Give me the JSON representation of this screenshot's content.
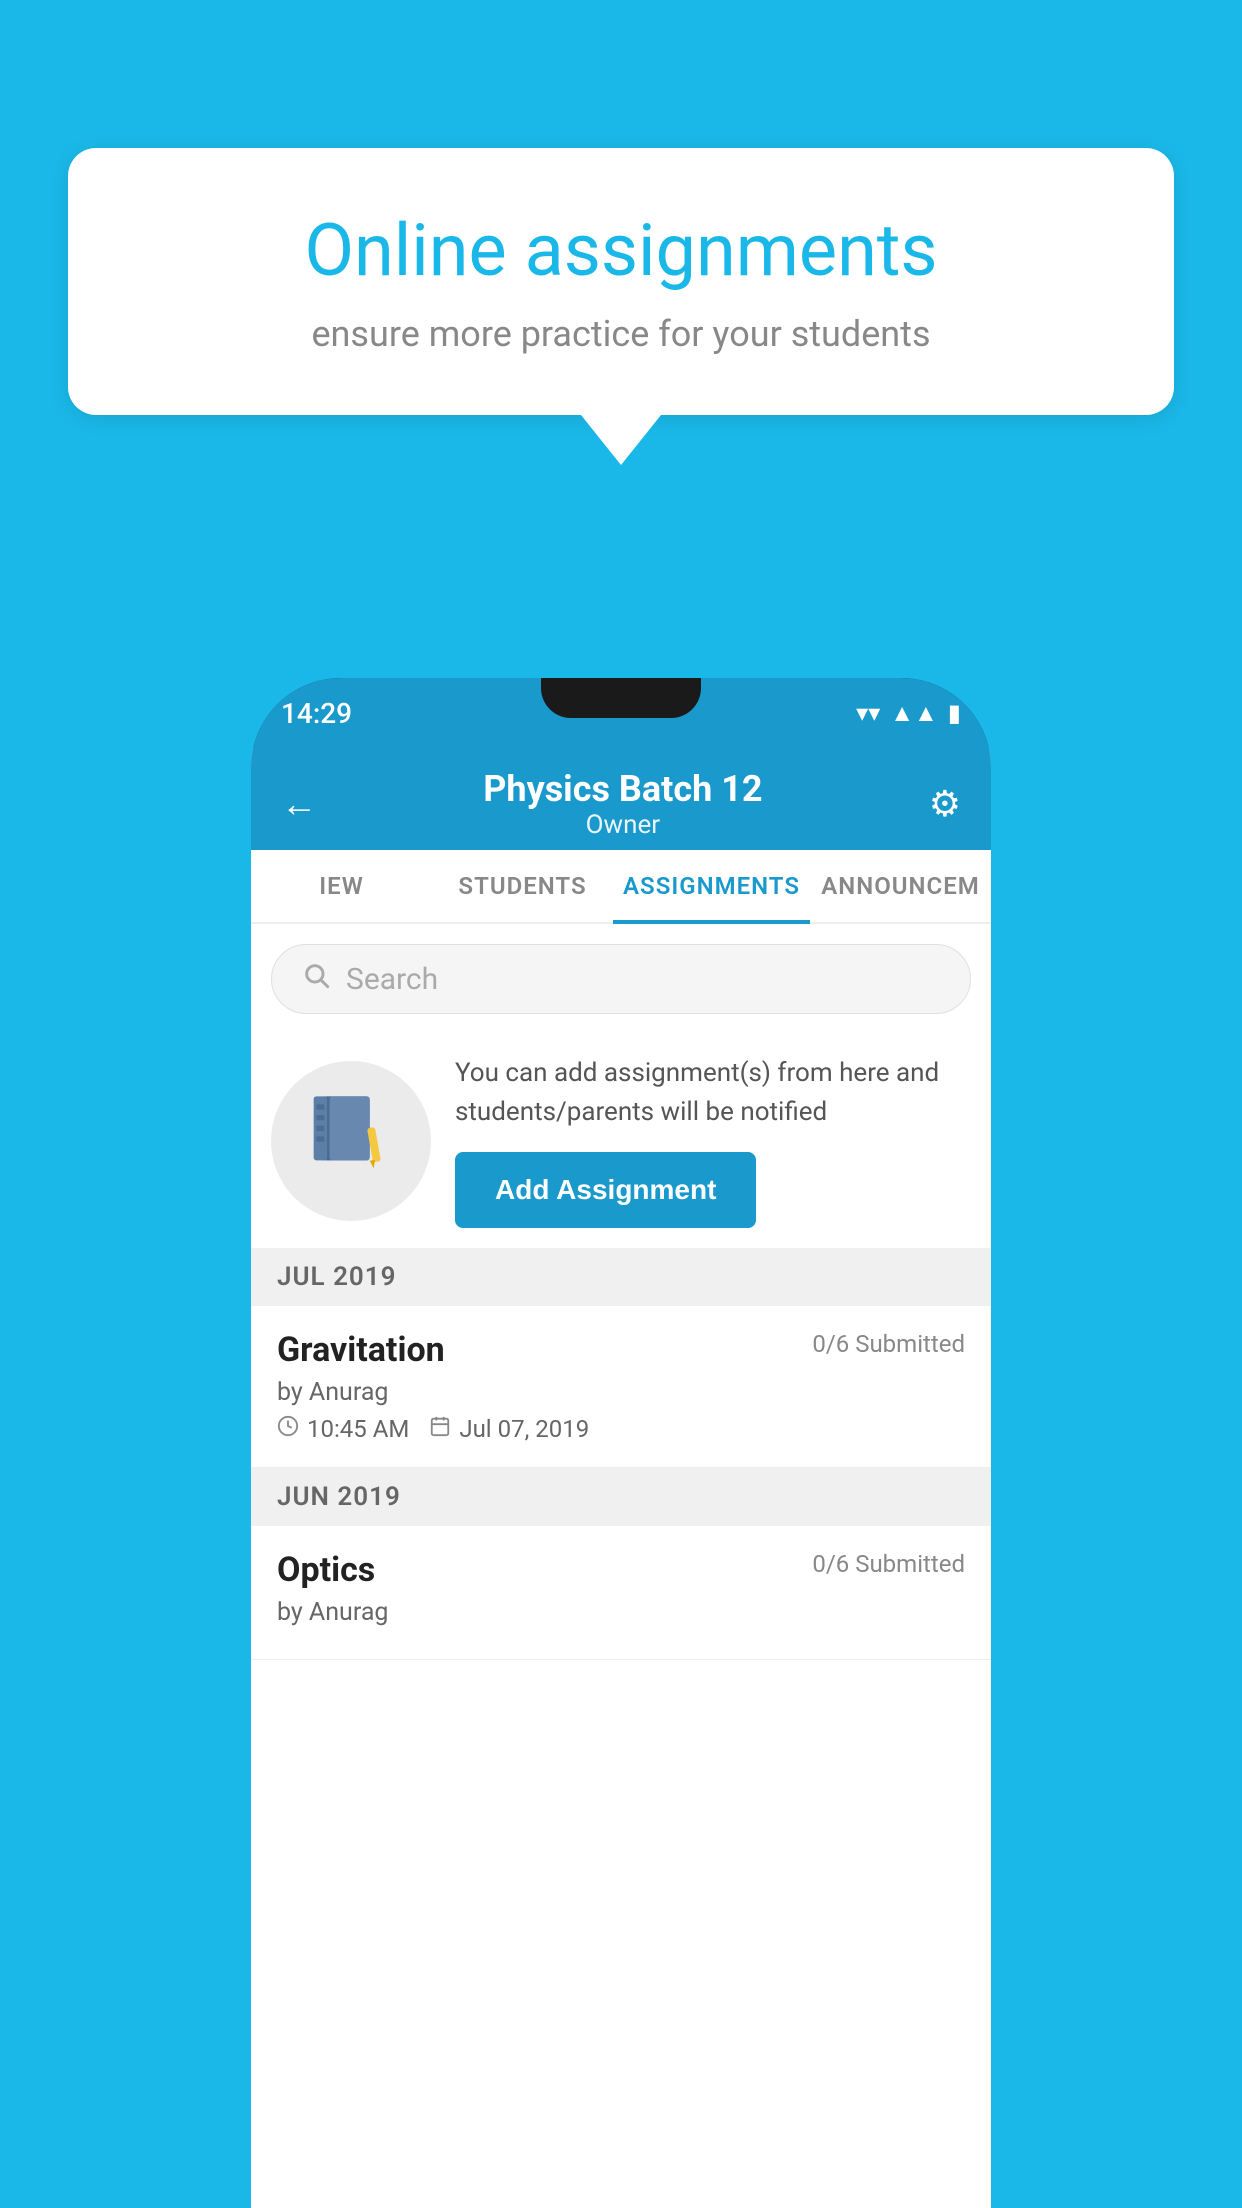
{
  "background": {
    "color": "#1ab8e8"
  },
  "speech_bubble": {
    "title": "Online assignments",
    "subtitle": "ensure more practice for your students"
  },
  "phone": {
    "status_bar": {
      "time": "14:29"
    },
    "header": {
      "title": "Physics Batch 12",
      "subtitle": "Owner"
    },
    "tabs": [
      {
        "label": "IEW",
        "active": false
      },
      {
        "label": "STUDENTS",
        "active": false
      },
      {
        "label": "ASSIGNMENTS",
        "active": true
      },
      {
        "label": "ANNOUNCEM",
        "active": false
      }
    ],
    "search": {
      "placeholder": "Search"
    },
    "info_card": {
      "description": "You can add assignment(s) from here and students/parents will be notified",
      "button_label": "Add Assignment"
    },
    "sections": [
      {
        "header": "JUL 2019",
        "assignments": [
          {
            "title": "Gravitation",
            "submitted": "0/6 Submitted",
            "author": "by Anurag",
            "time": "10:45 AM",
            "date": "Jul 07, 2019"
          }
        ]
      },
      {
        "header": "JUN 2019",
        "assignments": [
          {
            "title": "Optics",
            "submitted": "0/6 Submitted",
            "author": "by Anurag",
            "time": "",
            "date": ""
          }
        ]
      }
    ]
  }
}
